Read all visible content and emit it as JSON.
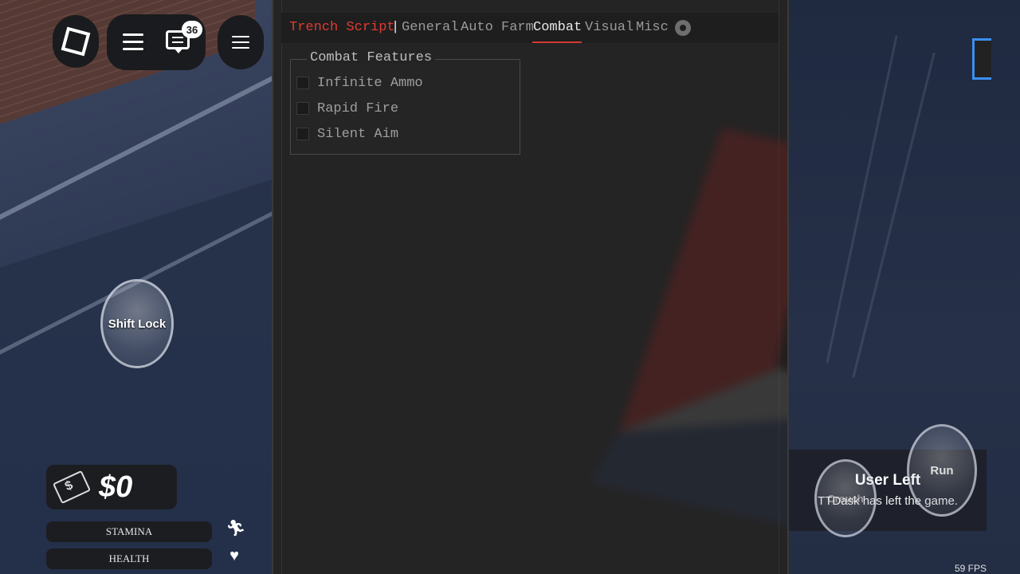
{
  "hud": {
    "chat_badge": "36",
    "money": "$0",
    "stamina_label": "STAMINA",
    "health_label": "HEALTH",
    "shift_lock_label": "Shift Lock",
    "fps": "59 FPS"
  },
  "notification": {
    "title": "User Left",
    "message": "TTDask has left the game."
  },
  "buttons": {
    "run_label": "Run",
    "crouch_label": "Crouch"
  },
  "script_window": {
    "title": "Trench Script",
    "separator": "|",
    "tabs": [
      {
        "label": "General",
        "active": false
      },
      {
        "label": "Auto Farm",
        "active": false
      },
      {
        "label": "Combat",
        "active": true
      },
      {
        "label": "Visual",
        "active": false
      },
      {
        "label": "Misc",
        "active": false
      }
    ],
    "settings_icon": "gear-icon",
    "group": {
      "title": "Combat Features",
      "options": [
        {
          "label": "Infinite Ammo",
          "checked": false
        },
        {
          "label": "Rapid Fire",
          "checked": false
        },
        {
          "label": "Silent Aim",
          "checked": false
        }
      ]
    }
  },
  "colors": {
    "accent": "#e03b32",
    "window_bg": "#242424",
    "avatar_border": "#3b8ff0"
  }
}
